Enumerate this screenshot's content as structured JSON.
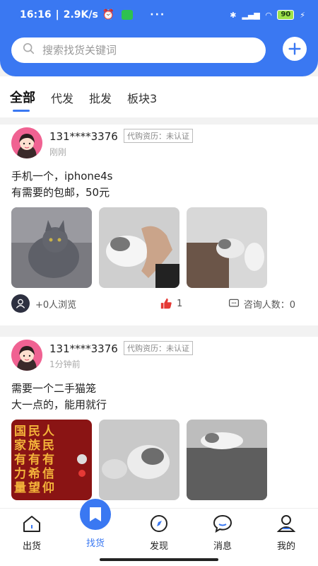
{
  "status": {
    "time": "16:16",
    "net_speed": "2.9K/s",
    "battery": "90",
    "dots": "···"
  },
  "search": {
    "placeholder": "搜索找货关键词"
  },
  "tabs": [
    {
      "label": "全部",
      "active": true
    },
    {
      "label": "代发",
      "active": false
    },
    {
      "label": "批发",
      "active": false
    },
    {
      "label": "板块3",
      "active": false
    }
  ],
  "posts": [
    {
      "user": "131****3376",
      "badge": "代购资历：未认证",
      "time": "刚刚",
      "text_line1": "手机一个，iphone4s",
      "text_line2": "有需要的包邮，50元",
      "views": "+0人浏览",
      "likes": "1",
      "consult": "咨询人数：0"
    },
    {
      "user": "131****3376",
      "badge": "代购资历：未认证",
      "time": "1分钟前",
      "text_line1": "需要一个二手猫笼",
      "text_line2": "大一点的，能用就行",
      "poster_chars": [
        "国",
        "民",
        "人",
        "家",
        "族",
        "民",
        "有",
        "有",
        "有",
        "力",
        "希",
        "信",
        "量",
        "望",
        "仰"
      ]
    }
  ],
  "nav": [
    {
      "label": "出货",
      "icon": "home-icon"
    },
    {
      "label": "找货",
      "icon": "find-icon",
      "active": true
    },
    {
      "label": "发现",
      "icon": "compass-icon"
    },
    {
      "label": "消息",
      "icon": "message-icon"
    },
    {
      "label": "我的",
      "icon": "profile-icon"
    }
  ],
  "colors": {
    "primary": "#3a78f2",
    "like": "#e53935"
  }
}
